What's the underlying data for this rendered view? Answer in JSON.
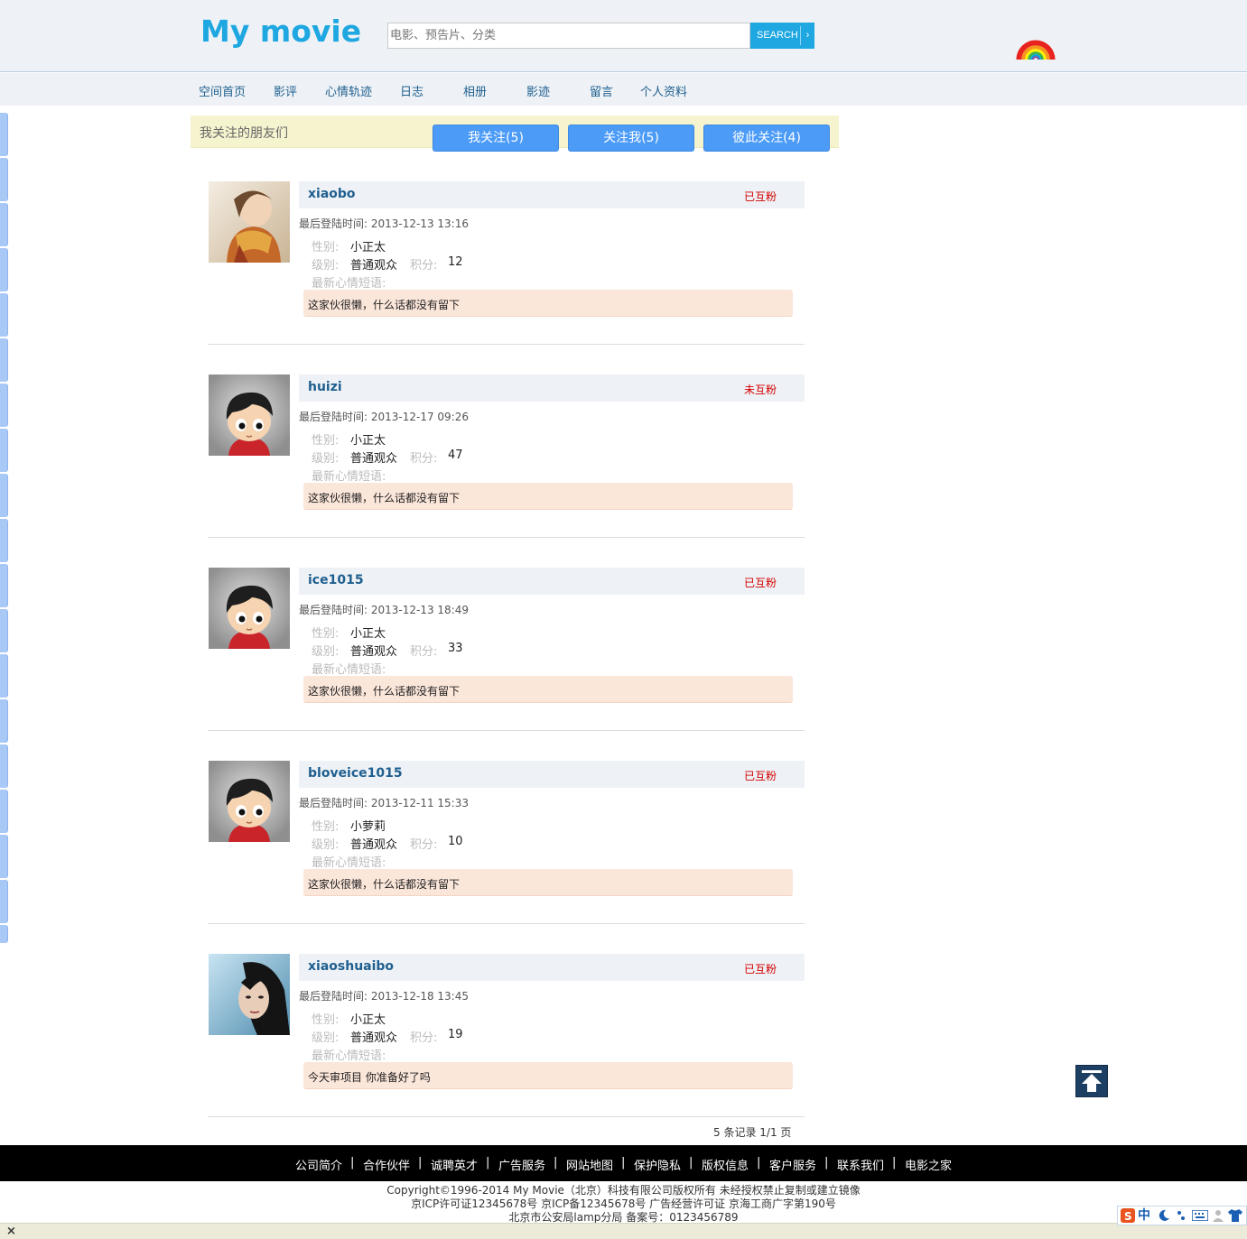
{
  "header": {
    "logo": "My movie",
    "search_placeholder": "电影、预告片、分类",
    "search_button": "SEARCH",
    "search_arrow": "›"
  },
  "nav": {
    "items": [
      {
        "label": "空间首页"
      },
      {
        "label": "影评"
      },
      {
        "label": "心情轨迹"
      },
      {
        "label": "日志"
      },
      {
        "label": "相册"
      },
      {
        "label": "影迹"
      },
      {
        "label": "留言"
      },
      {
        "label": "个人资料"
      }
    ]
  },
  "friends": {
    "title": "我关注的朋友们",
    "tabs": [
      {
        "label": "我关注(5)"
      },
      {
        "label": "关注我(5)"
      },
      {
        "label": "彼此关注(4)"
      }
    ]
  },
  "labels": {
    "gender": "性别:",
    "level": "级别:",
    "score": "积分:",
    "mood": "最新心情短语:"
  },
  "cards": [
    {
      "name": "xiaobo",
      "status": "已互粉",
      "last_login": "最后登陆时间: 2013-12-13 13:16",
      "gender": "小正太",
      "level": "普通观众",
      "score": "12",
      "mood": "这家伙很懒，什么话都没有留下",
      "avatar": "photo-girl-scarf"
    },
    {
      "name": "huizi",
      "status": "未互粉",
      "last_login": "最后登陆时间: 2013-12-17 09:26",
      "gender": "小正太",
      "level": "普通观众",
      "score": "47",
      "mood": "这家伙很懒，什么话都没有留下",
      "avatar": "cartoon-boy"
    },
    {
      "name": "ice1015",
      "status": "已互粉",
      "last_login": "最后登陆时间: 2013-12-13 18:49",
      "gender": "小正太",
      "level": "普通观众",
      "score": "33",
      "mood": "这家伙很懒，什么话都没有留下",
      "avatar": "cartoon-boy"
    },
    {
      "name": "bloveice1015",
      "status": "已互粉",
      "last_login": "最后登陆时间: 2013-12-11 15:33",
      "gender": "小萝莉",
      "level": "普通观众",
      "score": "10",
      "mood": "这家伙很懒，什么话都没有留下",
      "avatar": "cartoon-boy"
    },
    {
      "name": "xiaoshuaibo",
      "status": "已互粉",
      "last_login": "最后登陆时间: 2013-12-18 13:45",
      "gender": "小正太",
      "level": "普通观众",
      "score": "19",
      "mood": "今天审项目 你准备好了吗",
      "avatar": "photo-woman-blue"
    }
  ],
  "pager": "5 条记录 1/1 页",
  "footer": {
    "links": [
      {
        "label": "公司简介"
      },
      {
        "label": "合作伙伴"
      },
      {
        "label": "诚聘英才"
      },
      {
        "label": "广告服务"
      },
      {
        "label": "网站地图"
      },
      {
        "label": "保护隐私"
      },
      {
        "label": "版权信息"
      },
      {
        "label": "客户服务"
      },
      {
        "label": "联系我们"
      },
      {
        "label": "电影之家"
      }
    ],
    "separator": "|",
    "copyright": "Copyright©1996-2014 My Movie（北京）科技有限公司版权所有 未经授权禁止复制或建立镜像",
    "icp": "京ICP许可证12345678号 京ICP备12345678号    广告经营许可证 京海工商广字第190号",
    "police": "北京市公安局lamp分局 备案号：0123456789"
  },
  "bottom_bar": {
    "close": "×"
  },
  "ime": {
    "mode": "中"
  },
  "colors": {
    "accent": "#1ea7e1",
    "nav_text": "#1f5f8f",
    "tab_button": "#4b9bf7",
    "mutual_red": "#d40000",
    "mood_bg": "#fbe6da",
    "footer_bg": "#000000"
  }
}
